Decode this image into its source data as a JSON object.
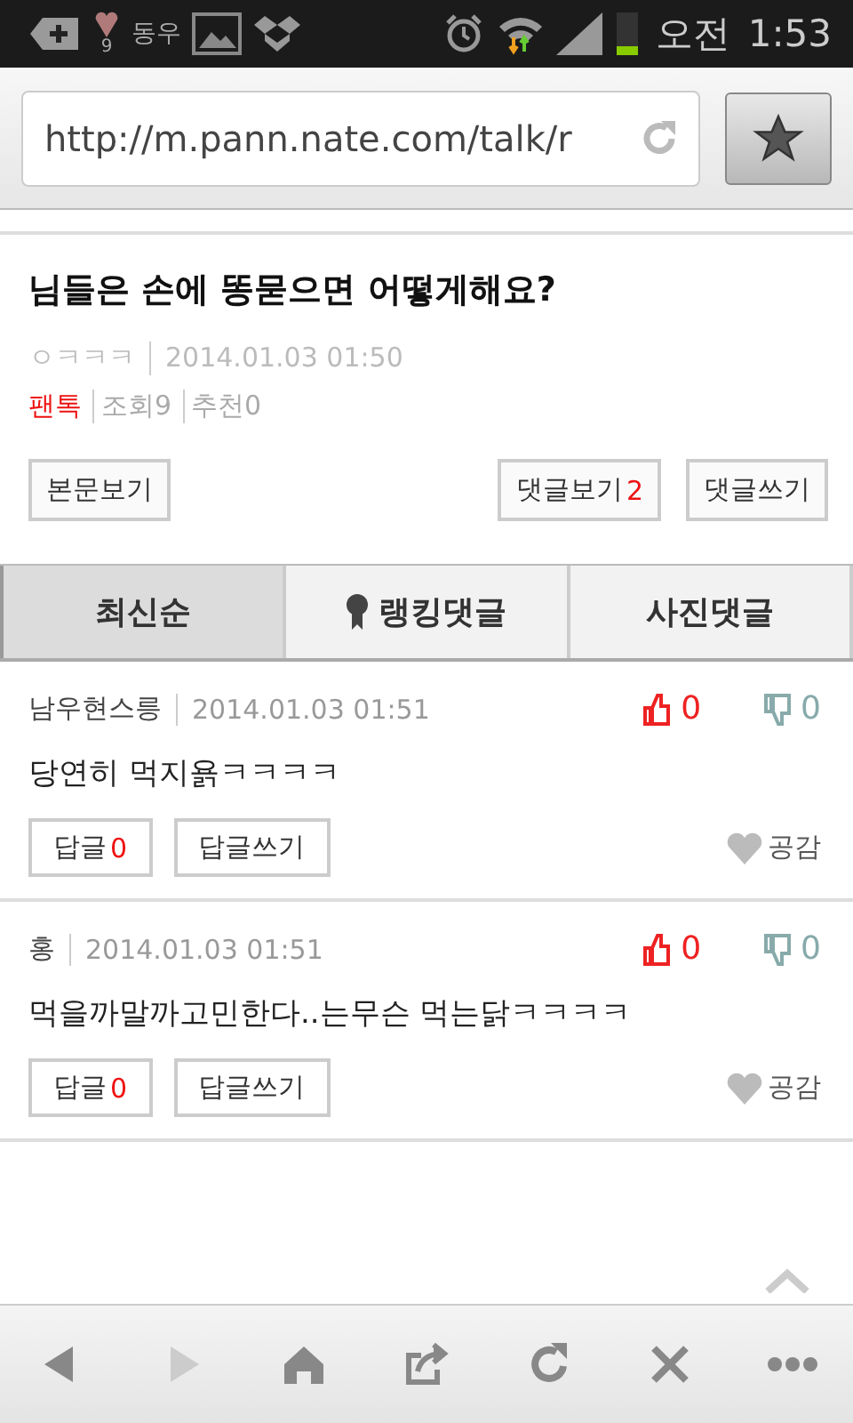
{
  "status_bar": {
    "notification_text": "동우",
    "badge": "9",
    "ampm": "오전",
    "time": "1:53"
  },
  "url_bar": {
    "value": "http://m.pann.nate.com/talk/r"
  },
  "post": {
    "title": "님들은 손에 똥묻으면 어떻게해요?",
    "author": "ㅇㅋㅋㅋ",
    "date": "2014.01.03 01:50",
    "category": "팬톡",
    "views": "조회9",
    "recommends": "추천0",
    "buttons": [
      {
        "label": "본문보기"
      },
      {
        "label": "댓글보기",
        "count": "2"
      },
      {
        "label": "댓글쓰기"
      }
    ]
  },
  "tabs": [
    {
      "label": "최신순",
      "selected": true,
      "icon": false
    },
    {
      "label": "랭킹댓글",
      "selected": false,
      "icon": true
    },
    {
      "label": "사진댓글",
      "selected": false,
      "icon": false
    }
  ],
  "comments": [
    {
      "author": "남우현스릉",
      "date": "2014.01.03 01:51",
      "likes": "0",
      "dislikes": "0",
      "text": "당연히 먹지욝ㅋㅋㅋㅋ",
      "reply_label": "답글",
      "reply_count": "0",
      "write_reply": "답글쓰기",
      "empathy": "공감"
    },
    {
      "author": "홍",
      "date": "2014.01.03 01:51",
      "likes": "0",
      "dislikes": "0",
      "text": "먹을까말까고민한다..는무슨 먹는닭ㅋㅋㅋㅋ",
      "reply_label": "답글",
      "reply_count": "0",
      "write_reply": "답글쓰기",
      "empathy": "공감"
    }
  ],
  "toolbar": [
    {
      "kind": "back",
      "disabled": false
    },
    {
      "kind": "forward",
      "disabled": true
    },
    {
      "kind": "home",
      "disabled": false
    },
    {
      "kind": "share",
      "disabled": false
    },
    {
      "kind": "reload",
      "disabled": false
    },
    {
      "kind": "close",
      "disabled": false
    },
    {
      "kind": "more",
      "disabled": false
    }
  ]
}
